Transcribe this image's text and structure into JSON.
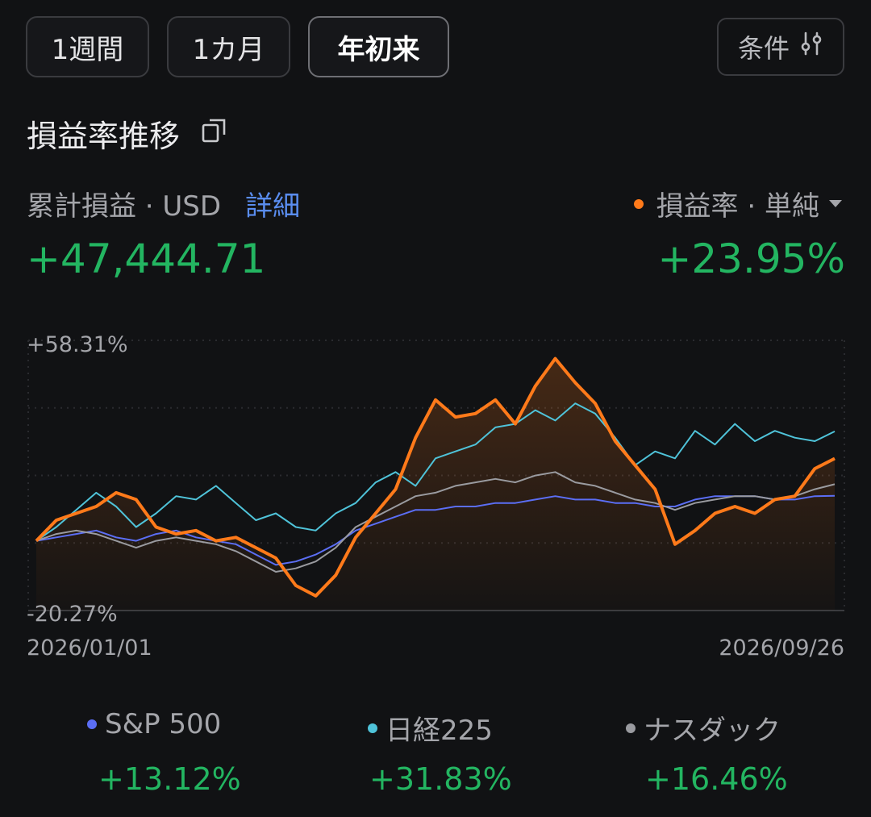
{
  "tabs": [
    {
      "label": "1週間",
      "active": false
    },
    {
      "label": "1カ月",
      "active": false
    },
    {
      "label": "年初来",
      "active": true
    }
  ],
  "filter": {
    "label": "条件",
    "icon": "sliders-icon"
  },
  "section": {
    "title": "損益率推移",
    "icon": "copy-icon"
  },
  "summary": {
    "left_label": "累計損益 · USD",
    "detail_link": "詳細",
    "left_value": "+47,444.71",
    "right_label": "損益率 · 単純",
    "right_value": "+23.95%"
  },
  "colors": {
    "accent_orange": "#ff7a1a",
    "positive_green": "#23b561",
    "sp500": "#5b6ef5",
    "nikkei": "#4fc3d9",
    "nasdaq": "#9a9ba0",
    "link_blue": "#5a8df0"
  },
  "chart_data": {
    "type": "line",
    "y_max_label": "+58.31%",
    "y_min_label": "-20.27%",
    "ylim": [
      -20.27,
      58.31
    ],
    "x_start_label": "2026/01/01",
    "x_end_label": "2026/09/26",
    "grid": true,
    "series": [
      {
        "name": "損益率",
        "color": "#ff7a1a",
        "fill": true,
        "values": [
          0,
          6,
          8,
          10,
          14,
          12,
          4,
          2,
          3,
          0,
          1,
          -2,
          -5,
          -13,
          -16,
          -10,
          1,
          8,
          15,
          30,
          41,
          36,
          37,
          41,
          34,
          45,
          53,
          46,
          40,
          29,
          22,
          15,
          -1,
          3,
          8,
          10,
          8,
          12,
          13,
          21,
          23.95
        ]
      },
      {
        "name": "日経225",
        "color": "#4fc3d9",
        "fill": false,
        "values": [
          0,
          4,
          9,
          14,
          10,
          4,
          8,
          13,
          12,
          16,
          11,
          6,
          8,
          4,
          3,
          8,
          11,
          17,
          20,
          16,
          24,
          26,
          28,
          33,
          34,
          38,
          35,
          40,
          37,
          30,
          22,
          26,
          24,
          32,
          28,
          34,
          29,
          32,
          30,
          29,
          31.83
        ]
      },
      {
        "name": "S&P 500",
        "color": "#5b6ef5",
        "fill": false,
        "values": [
          0,
          1,
          2,
          3,
          1,
          0,
          2,
          3,
          1,
          0,
          -1,
          -4,
          -7,
          -6,
          -4,
          -1,
          3,
          5,
          7,
          9,
          9,
          10,
          10,
          11,
          11,
          12,
          13,
          12,
          12,
          11,
          11,
          10,
          10,
          12,
          13,
          13,
          13,
          12,
          12,
          13,
          13.12
        ]
      },
      {
        "name": "ナスダック",
        "color": "#9a9ba0",
        "fill": false,
        "values": [
          0,
          2,
          3,
          2,
          0,
          -2,
          0,
          1,
          0,
          -1,
          -3,
          -6,
          -9,
          -8,
          -6,
          -2,
          4,
          7,
          10,
          13,
          14,
          16,
          17,
          18,
          17,
          19,
          20,
          17,
          16,
          14,
          12,
          11,
          9,
          11,
          12,
          13,
          13,
          12,
          13,
          15,
          16.46
        ]
      }
    ]
  },
  "legend": [
    {
      "name": "S&P 500",
      "value": "+13.12%",
      "color": "#5b6ef5"
    },
    {
      "name": "日経225",
      "value": "+31.83%",
      "color": "#4fc3d9"
    },
    {
      "name": "ナスダック",
      "value": "+16.46%",
      "color": "#9a9ba0"
    }
  ]
}
